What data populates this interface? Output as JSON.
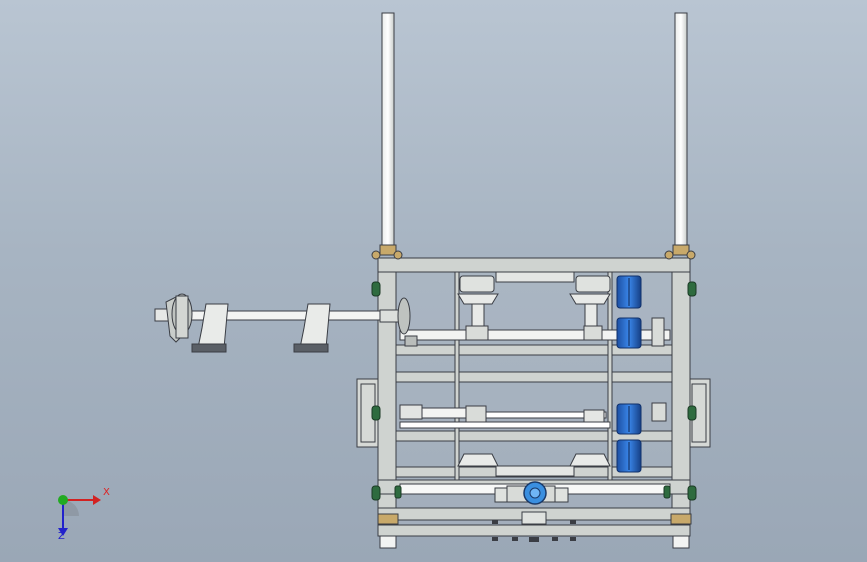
{
  "viewport": {
    "background_top": "#b9c5d2",
    "background_bottom": "#9aa7b6",
    "model_description_icon": "machine-frame-icon"
  },
  "colors": {
    "frame_fill": "#cfd3d0",
    "frame_stroke": "#3a3d44",
    "motor_blue": "#2a6fd0",
    "bracket_green": "#2e6b3f",
    "valve_blue": "#3a8fe0",
    "bolt_tan": "#c8a96a"
  },
  "triad": {
    "x_label": "X",
    "z_label": "Z",
    "x_color": "#d22222",
    "y_color": "#22aa22",
    "z_color": "#2222cc"
  }
}
